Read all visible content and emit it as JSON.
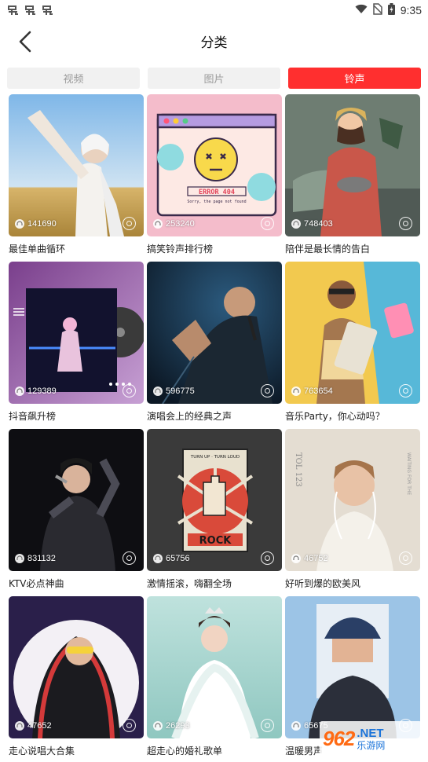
{
  "status_bar": {
    "time": "9:35",
    "left_icons": [
      "app-notification-icon",
      "app-notification-icon",
      "app-notification-icon"
    ],
    "right_icons": [
      "wifi-icon",
      "no-sim-icon",
      "battery-icon"
    ]
  },
  "header": {
    "title": "分类",
    "back_icon": "chevron-left-icon"
  },
  "tabs": [
    {
      "label": "视频",
      "active": false
    },
    {
      "label": "图片",
      "active": false
    },
    {
      "label": "铃声",
      "active": true
    }
  ],
  "colors": {
    "accent": "#ff2f2f",
    "tab_inactive_bg": "#f1f1f1",
    "tab_inactive_text": "#9b9b9b"
  },
  "categories": [
    {
      "title": "最佳单曲循环",
      "plays": "141690"
    },
    {
      "title": "搞笑铃声排行榜",
      "plays": "253240"
    },
    {
      "title": "陪伴是最长情的告白",
      "plays": "748403"
    },
    {
      "title": "抖音飙升榜",
      "plays": "129389"
    },
    {
      "title": "演唱会上的经典之声",
      "plays": "596775"
    },
    {
      "title": "音乐Party，你心动吗？",
      "plays": "763654"
    },
    {
      "title": "KTV必点神曲",
      "plays": "831132"
    },
    {
      "title": "激情摇滚，嗨翻全场",
      "plays": "65756"
    },
    {
      "title": "好听到爆的欧美风",
      "plays": "46752"
    },
    {
      "title": "走心说唱大合集",
      "plays": "47652"
    },
    {
      "title": "超走心的婚礼歌单",
      "plays": "26293"
    },
    {
      "title": "温暖男声",
      "plays": "65675"
    }
  ],
  "artwork_text": {
    "error_code": "ERROR 404",
    "error_sub": "Sorry, the page not found",
    "rock": "ROCK",
    "rock_banner": "TURN UP · TURN LOUD",
    "poster_side": "TOL 123",
    "poster_waiting": "WAITING FOR THE"
  },
  "watermark": {
    "number": "962",
    "domain": ".NET",
    "cn": "乐游网"
  }
}
